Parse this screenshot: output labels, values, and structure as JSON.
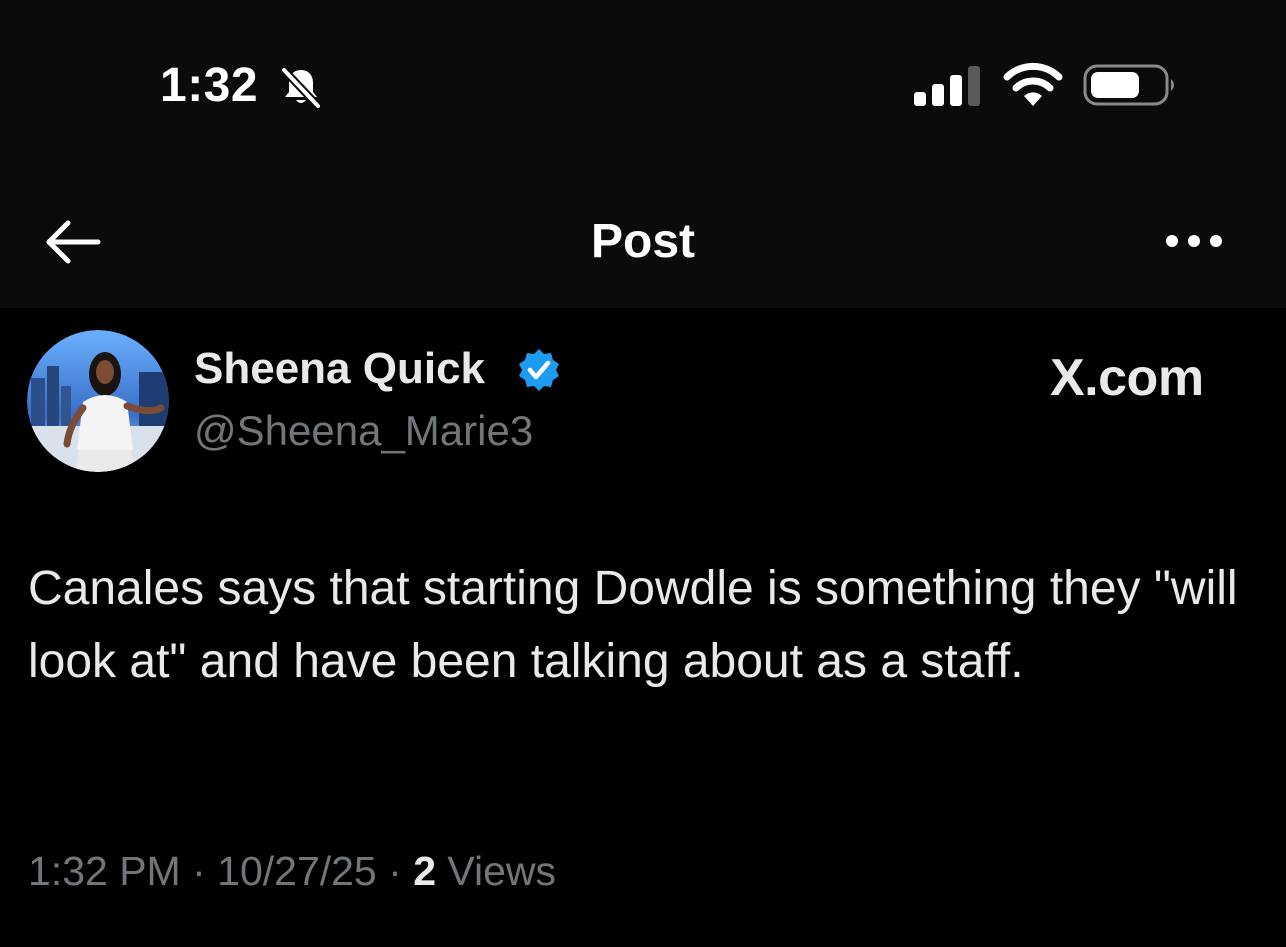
{
  "status_bar": {
    "time": "1:32",
    "silent_icon": "bell-slash-icon",
    "signal_icon": "cellular-signal-icon",
    "wifi_icon": "wifi-icon",
    "battery_icon": "battery-icon"
  },
  "nav": {
    "back_icon": "arrow-left-icon",
    "title": "Post",
    "more_icon": "ellipsis-icon"
  },
  "post": {
    "author_name": "Sheena Quick",
    "verified": true,
    "verified_color": "#1d9bf0",
    "author_handle": "@Sheena_Marie3",
    "watermark": "X.com",
    "text": "Canales says that starting Dowdle is something they \"will look at\" and have been talking about as a staff.",
    "time": "1:32 PM",
    "separator": " · ",
    "date": "10/27/25",
    "views_count": "2",
    "views_label": "Views"
  },
  "colors": {
    "background": "#000000",
    "header_background": "#0b0b0b",
    "primary_text": "#e7e9ea",
    "secondary_text": "#71767b"
  }
}
